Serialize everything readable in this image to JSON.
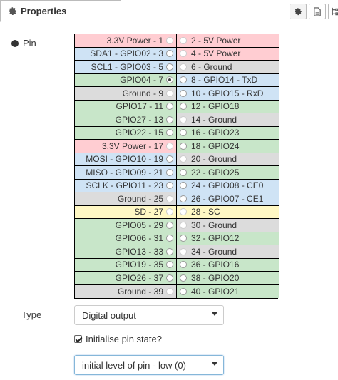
{
  "header": {
    "tab_label": "Properties",
    "tab_icon": "gear-icon",
    "buttons": [
      {
        "icon": "gear-icon"
      },
      {
        "icon": "document-icon"
      },
      {
        "icon": "tree-icon"
      }
    ]
  },
  "pin": {
    "label": "Pin",
    "selected_pin": 7,
    "rows": [
      {
        "left": "3.3V Power - 1",
        "left_type": "power",
        "left_selectable": false,
        "right": "2 - 5V Power",
        "right_type": "power",
        "right_selectable": false
      },
      {
        "left": "SDA1 - GPIO02 - 3",
        "left_type": "serial",
        "left_selectable": true,
        "right": "4 - 5V Power",
        "right_type": "power",
        "right_selectable": false
      },
      {
        "left": "SCL1 - GPIO03 - 5",
        "left_type": "serial",
        "left_selectable": true,
        "right": "6 - Ground",
        "right_type": "ground",
        "right_selectable": false
      },
      {
        "left": "GPIO04 - 7",
        "left_type": "gpio",
        "left_selectable": true,
        "right": "8 - GPIO14 - TxD",
        "right_type": "serial",
        "right_selectable": true
      },
      {
        "left": "Ground - 9",
        "left_type": "ground",
        "left_selectable": false,
        "right": "10 - GPIO15 - RxD",
        "right_type": "serial",
        "right_selectable": true
      },
      {
        "left": "GPIO17 - 11",
        "left_type": "gpio",
        "left_selectable": true,
        "right": "12 - GPIO18",
        "right_type": "gpio",
        "right_selectable": true
      },
      {
        "left": "GPIO27 - 13",
        "left_type": "gpio",
        "left_selectable": true,
        "right": "14 - Ground",
        "right_type": "ground",
        "right_selectable": false
      },
      {
        "left": "GPIO22 - 15",
        "left_type": "gpio",
        "left_selectable": true,
        "right": "16 - GPIO23",
        "right_type": "gpio",
        "right_selectable": true
      },
      {
        "left": "3.3V Power - 17",
        "left_type": "power",
        "left_selectable": false,
        "right": "18 - GPIO24",
        "right_type": "gpio",
        "right_selectable": true
      },
      {
        "left": "MOSI - GPIO10 - 19",
        "left_type": "serial",
        "left_selectable": true,
        "right": "20 - Ground",
        "right_type": "ground",
        "right_selectable": false
      },
      {
        "left": "MISO - GPIO09 - 21",
        "left_type": "serial",
        "left_selectable": true,
        "right": "22 - GPIO25",
        "right_type": "gpio",
        "right_selectable": true
      },
      {
        "left": "SCLK - GPIO11 - 23",
        "left_type": "serial",
        "left_selectable": true,
        "right": "24 - GPIO08 - CE0",
        "right_type": "serial",
        "right_selectable": true
      },
      {
        "left": "Ground - 25",
        "left_type": "ground",
        "left_selectable": false,
        "right": "26 - GPIO07 - CE1",
        "right_type": "serial",
        "right_selectable": true
      },
      {
        "left": "SD - 27",
        "left_type": "sd",
        "left_selectable": false,
        "right": "28 - SC",
        "right_type": "sd",
        "right_selectable": false
      },
      {
        "left": "GPIO05 - 29",
        "left_type": "gpio",
        "left_selectable": true,
        "right": "30 - Ground",
        "right_type": "ground",
        "right_selectable": false
      },
      {
        "left": "GPIO06 - 31",
        "left_type": "gpio",
        "left_selectable": true,
        "right": "32 - GPIO12",
        "right_type": "gpio",
        "right_selectable": true
      },
      {
        "left": "GPIO13 - 33",
        "left_type": "gpio",
        "left_selectable": true,
        "right": "34 - Ground",
        "right_type": "ground",
        "right_selectable": false
      },
      {
        "left": "GPIO19 - 35",
        "left_type": "gpio",
        "left_selectable": true,
        "right": "36 - GPIO16",
        "right_type": "gpio",
        "right_selectable": true
      },
      {
        "left": "GPIO26 - 37",
        "left_type": "gpio",
        "left_selectable": true,
        "right": "38 - GPIO20",
        "right_type": "gpio",
        "right_selectable": true
      },
      {
        "left": "Ground - 39",
        "left_type": "ground",
        "left_selectable": false,
        "right": "40 - GPIO21",
        "right_type": "gpio",
        "right_selectable": true
      }
    ]
  },
  "type": {
    "label": "Type",
    "value": "Digital output"
  },
  "init": {
    "label": "Initialise pin state?",
    "checked": true
  },
  "level": {
    "value": "initial level of pin - low (0)"
  },
  "colors": {
    "power": "#ffcdd2",
    "ground": "#dcdcdc",
    "gpio": "#c8e6c9",
    "serial": "#cfe3f5",
    "sd": "#fff8c4"
  }
}
